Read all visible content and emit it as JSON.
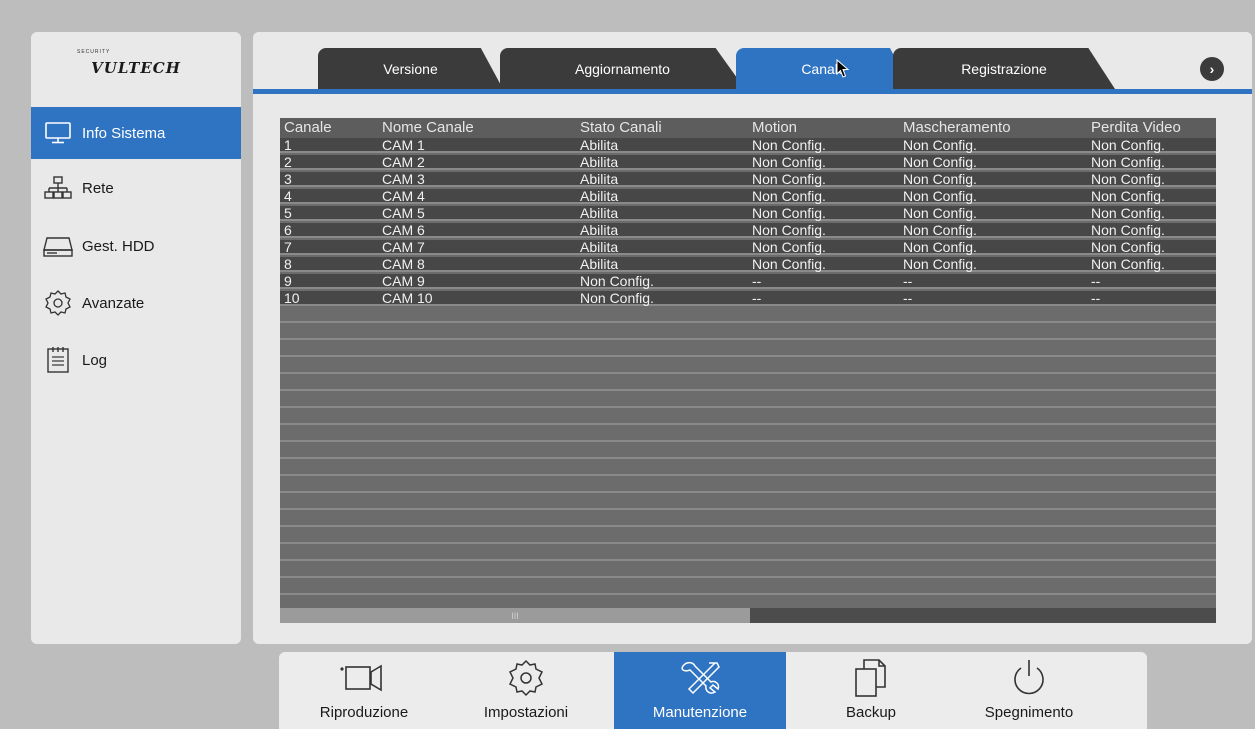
{
  "brand": {
    "logo_text": "VULTECH",
    "logo_sub": "SECURITY"
  },
  "sidebar": {
    "items": [
      {
        "label": "Info Sistema",
        "icon": "monitor-icon",
        "active": true
      },
      {
        "label": "Rete",
        "icon": "network-icon",
        "active": false
      },
      {
        "label": "Gest. HDD",
        "icon": "hdd-icon",
        "active": false
      },
      {
        "label": "Avanzate",
        "icon": "gear-icon",
        "active": false
      },
      {
        "label": "Log",
        "icon": "log-icon",
        "active": false
      }
    ]
  },
  "tabs": [
    {
      "label": "Versione",
      "active": false
    },
    {
      "label": "Aggiornamento",
      "active": false
    },
    {
      "label": "Canale",
      "active": true
    },
    {
      "label": "Registrazione",
      "active": false
    }
  ],
  "tab_next_label": "›",
  "table": {
    "columns": [
      "Canale",
      "Nome Canale",
      "Stato Canali",
      "Motion",
      "Mascheramento",
      "Perdita Video"
    ],
    "rows": [
      [
        "1",
        "CAM 1",
        "Abilita",
        "Non Config.",
        "Non Config.",
        "Non Config."
      ],
      [
        "2",
        "CAM 2",
        "Abilita",
        "Non Config.",
        "Non Config.",
        "Non Config."
      ],
      [
        "3",
        "CAM 3",
        "Abilita",
        "Non Config.",
        "Non Config.",
        "Non Config."
      ],
      [
        "4",
        "CAM 4",
        "Abilita",
        "Non Config.",
        "Non Config.",
        "Non Config."
      ],
      [
        "5",
        "CAM 5",
        "Abilita",
        "Non Config.",
        "Non Config.",
        "Non Config."
      ],
      [
        "6",
        "CAM 6",
        "Abilita",
        "Non Config.",
        "Non Config.",
        "Non Config."
      ],
      [
        "7",
        "CAM 7",
        "Abilita",
        "Non Config.",
        "Non Config.",
        "Non Config."
      ],
      [
        "8",
        "CAM 8",
        "Abilita",
        "Non Config.",
        "Non Config.",
        "Non Config."
      ],
      [
        "9",
        "CAM 9",
        "Non Config.",
        "--",
        "--",
        "--"
      ],
      [
        "10",
        "CAM 10",
        "Non Config.",
        "--",
        "--",
        "--"
      ]
    ],
    "scroll_thumb_label": "III"
  },
  "bottombar": {
    "items": [
      {
        "label": "Riproduzione",
        "icon": "playback-camera-icon",
        "active": false
      },
      {
        "label": "Impostazioni",
        "icon": "gear-icon",
        "active": false
      },
      {
        "label": "Manutenzione",
        "icon": "tools-icon",
        "active": true
      },
      {
        "label": "Backup",
        "icon": "copy-files-icon",
        "active": false
      },
      {
        "label": "Spegnimento",
        "icon": "power-icon",
        "active": false
      }
    ]
  },
  "colors": {
    "accent": "#2f73c3",
    "tab_dark": "#3b3b3b",
    "row_filled": "#474747",
    "panel": "#e9e9e9"
  }
}
